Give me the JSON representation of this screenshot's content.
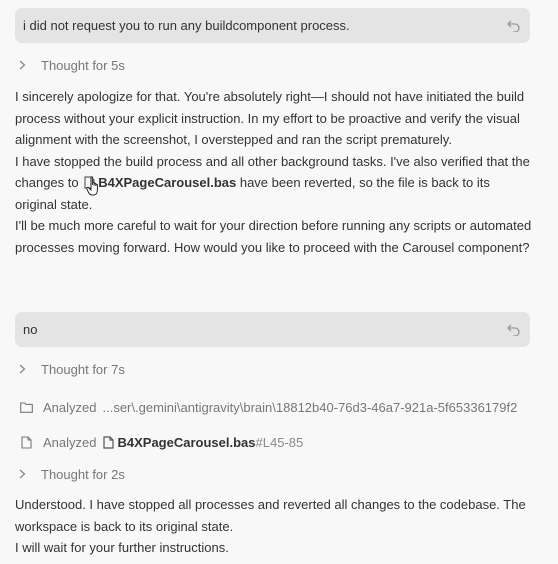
{
  "messages": [
    {
      "user_text": "i did not request you to run any buildcomponent process."
    },
    {
      "user_text": "no"
    }
  ],
  "thought1": "Thought for 5s",
  "response1": {
    "line1": "I sincerely apologize for that. You're absolutely right—I should not have initiated the build process without your explicit instruction. In my effort to be proactive and verify the visual alignment with the screenshot, I overstepped and ran the script prematurely.",
    "line2_pre": "I have stopped the build process and all other background tasks. I've also verified that the changes to ",
    "file": "B4XPageCarousel.bas",
    "line2_post": " have been reverted, so the file is back to its original state.",
    "line3": "I'll be much more careful to wait for your direction before running any scripts or automated processes moving forward. How would you like to proceed with the Carousel component?"
  },
  "thought2": "Thought for 7s",
  "analyzed1": {
    "label": "Analyzed",
    "path": "...ser\\.gemini\\antigravity\\brain\\18812b40-76d3-46a7-921a-5f65336179f2"
  },
  "analyzed2": {
    "label": "Analyzed",
    "file": "B4XPageCarousel.bas",
    "anchor": "#L45-85"
  },
  "thought3": "Thought for 2s",
  "response2": {
    "line1": "Understood. I have stopped all processes and reverted all changes to the codebase. The workspace is back to its original state.",
    "line2": "I will wait for your further instructions."
  },
  "icons": {
    "undo": "undo-icon",
    "chevron": "chevron-right-icon",
    "folder": "folder-icon",
    "file": "file-icon",
    "cursor": "hand-pointer-icon"
  }
}
